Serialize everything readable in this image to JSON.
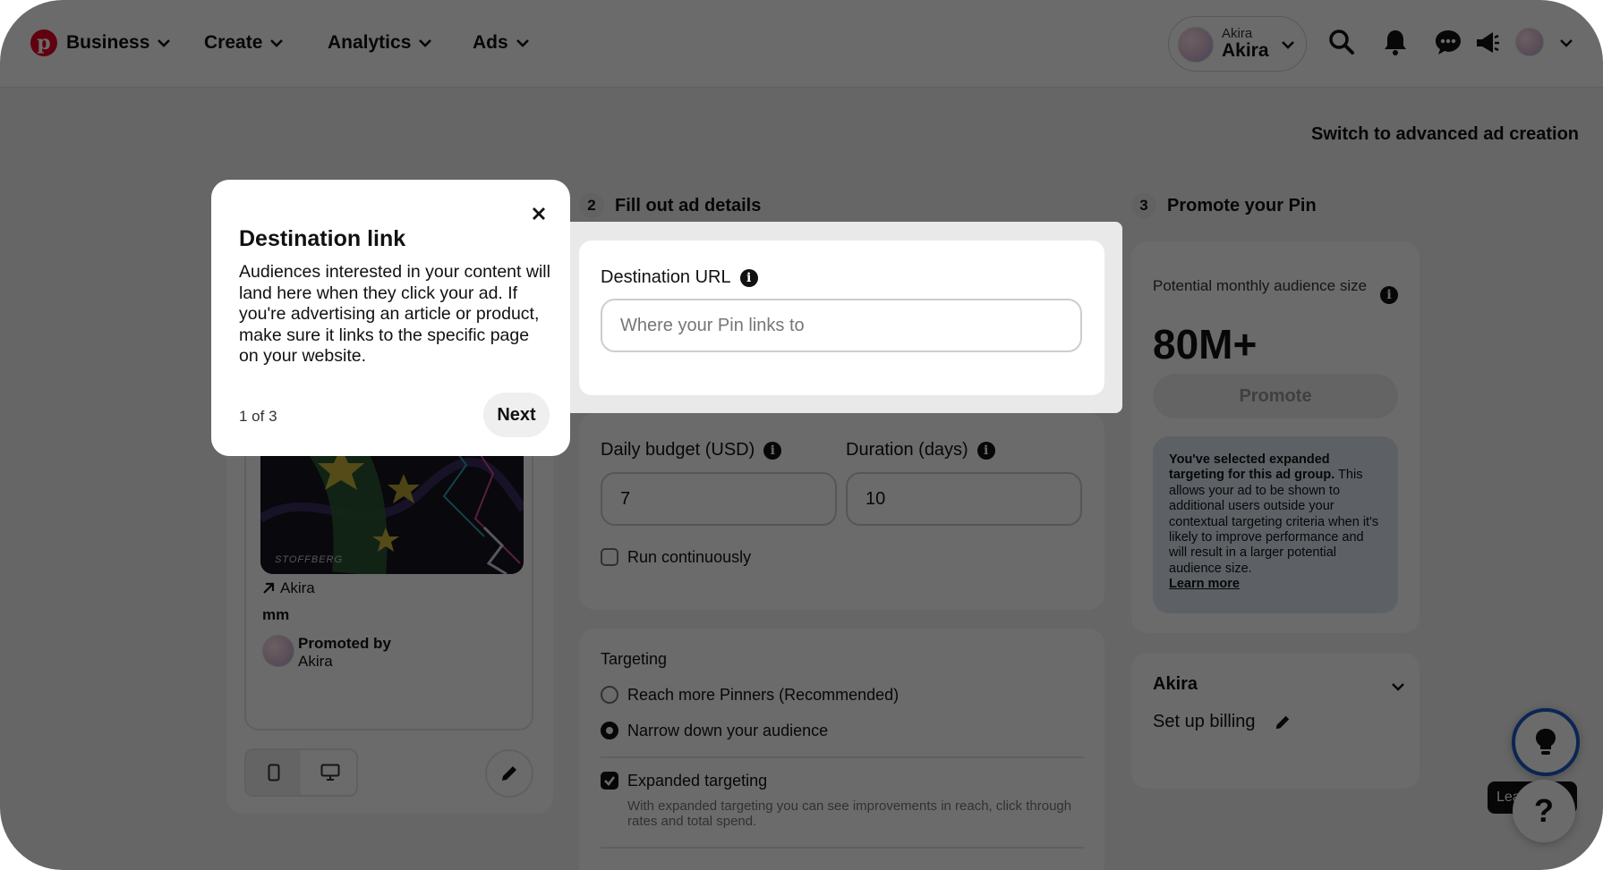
{
  "nav": {
    "brand": "Business",
    "items": [
      {
        "label": "Create"
      },
      {
        "label": "Analytics"
      },
      {
        "label": "Ads"
      }
    ],
    "account": {
      "name_small": "Akira",
      "name": "Akira"
    }
  },
  "page": {
    "switch_label": "Switch to advanced ad creation",
    "steps": [
      {
        "number": "2",
        "title": "Fill out ad details"
      },
      {
        "number": "3",
        "title": "Promote your Pin"
      }
    ]
  },
  "preview": {
    "watermark": "STOFFBERG",
    "link_label": "Akira",
    "pin_title": "mm",
    "promoted_by": "Promoted by",
    "promoter": "Akira"
  },
  "ad_details": {
    "destination_label": "Destination URL",
    "destination_placeholder": "Where your Pin links to",
    "budget_label": "Daily budget (USD)",
    "budget_value": "7",
    "duration_label": "Duration (days)",
    "duration_value": "10",
    "run_continuously": "Run continuously",
    "run_continuously_checked": false
  },
  "targeting": {
    "title": "Targeting",
    "options": [
      {
        "label": "Reach more Pinners (Recommended)",
        "selected": false
      },
      {
        "label": "Narrow down your audience",
        "selected": true
      }
    ],
    "expanded_label": "Expanded targeting",
    "expanded_checked": true,
    "expanded_help": "With expanded targeting you can see improvements in reach, click through rates and total spend."
  },
  "promote": {
    "audience_label": "Potential monthly audience size",
    "audience_value": "80M+",
    "promote_button": "Promote",
    "notice_bold": "You've selected expanded targeting for this ad group.",
    "notice_text": " This allows your ad to be shown to additional users outside your contextual targeting criteria when it's likely to improve performance and will result in a larger potential audience size.",
    "notice_link": "Learn more"
  },
  "billing": {
    "account": "Akira",
    "setup_label": "Set up billing"
  },
  "floating": {
    "tooltip": "Learn",
    "help_glyph": "?"
  },
  "popover": {
    "title": "Destination link",
    "body": "Audiences interested in your content will land here when they click your ad. If you're advertising an article or product, make sure it links to the specific page on your website.",
    "counter": "1 of 3",
    "next_label": "Next"
  },
  "colors": {
    "brand": "#e60023",
    "accent_ring": "#1b59c9",
    "notice_bg": "#dde7f2"
  }
}
